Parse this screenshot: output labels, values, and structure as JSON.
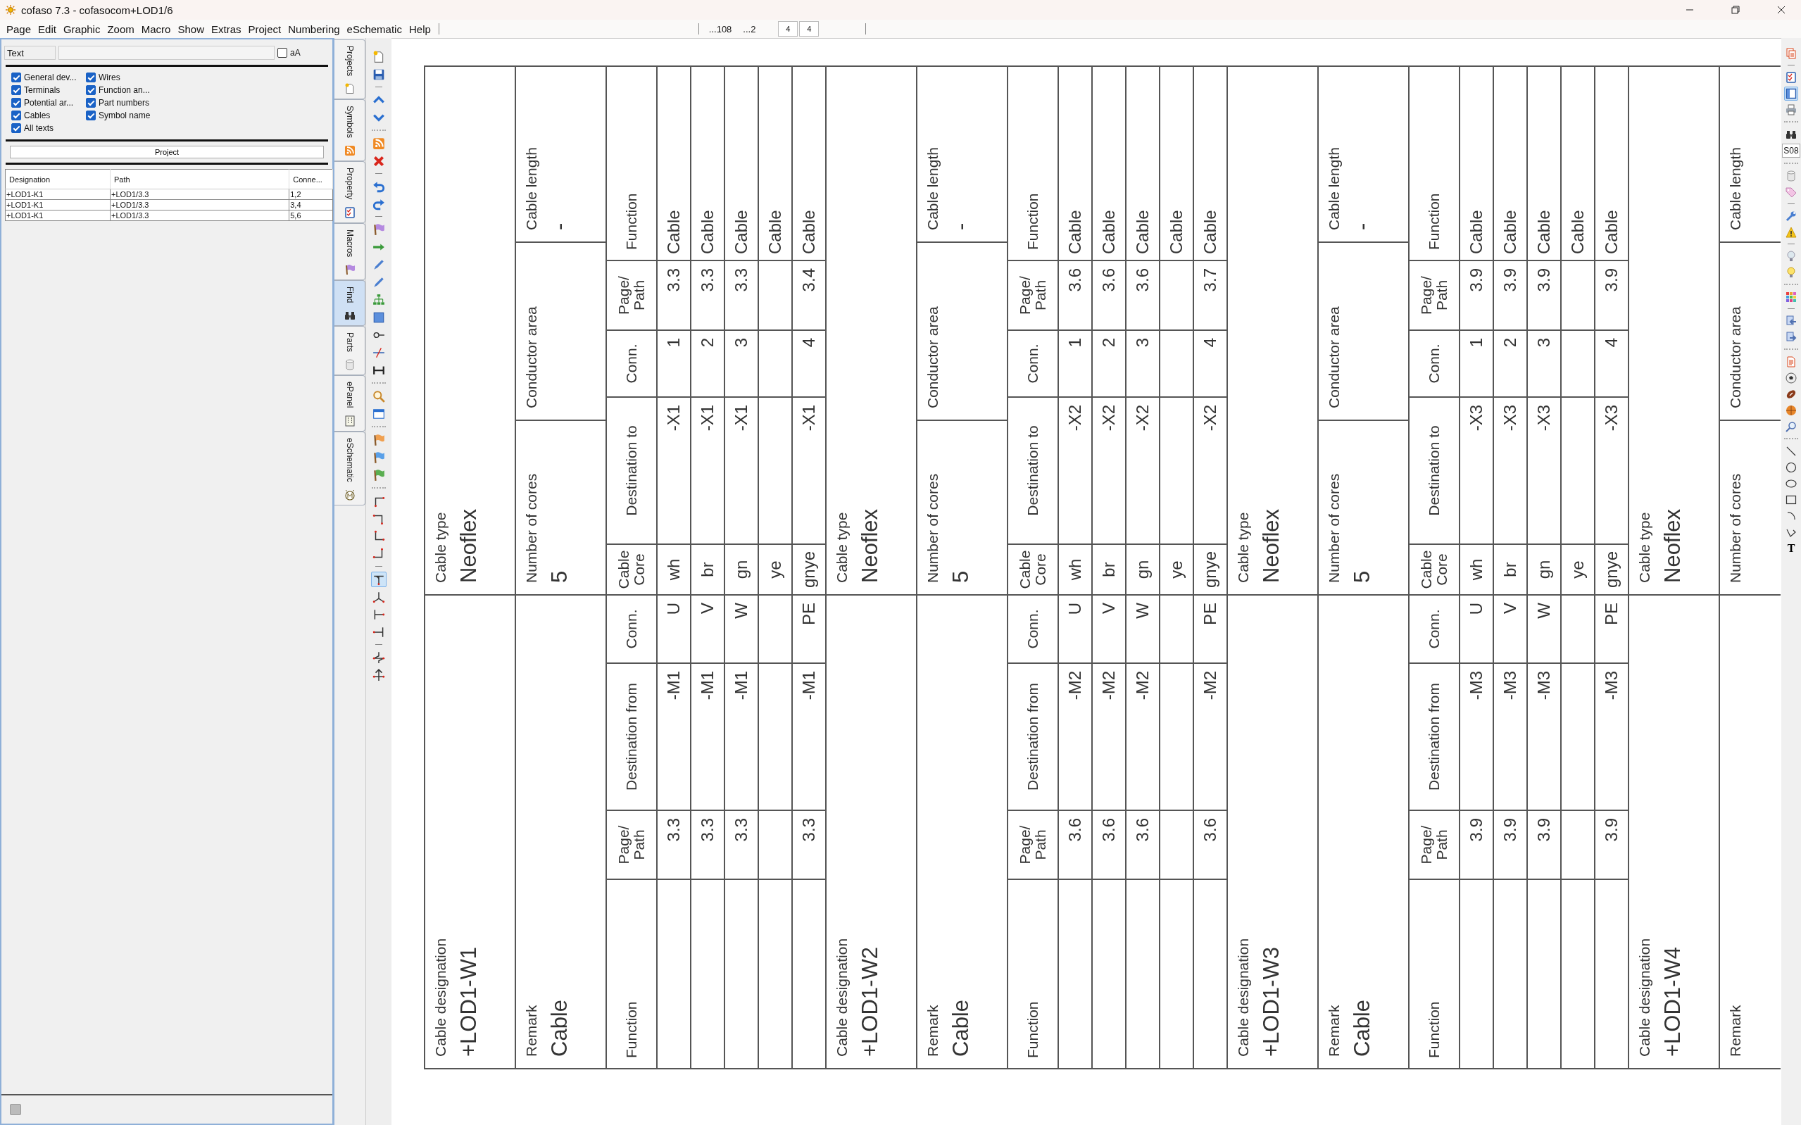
{
  "window": {
    "title": "cofaso 7.3 - cofasocom+LOD1/6"
  },
  "menu": [
    "Page",
    "Edit",
    "Graphic",
    "Zoom",
    "Macro",
    "Show",
    "Extras",
    "Project",
    "Numbering",
    "eSchematic",
    "Help"
  ],
  "menu_status": {
    "fields": [
      "...108",
      "...2"
    ],
    "boxes": [
      "4",
      "4"
    ]
  },
  "find_panel": {
    "search_label": "Text",
    "case_option": {
      "label": "aA",
      "checked": false
    },
    "filters": [
      {
        "label": "General dev...",
        "checked": true
      },
      {
        "label": "Wires",
        "checked": true
      },
      {
        "label": "Terminals",
        "checked": true
      },
      {
        "label": "Function an...",
        "checked": true
      },
      {
        "label": "Potential ar...",
        "checked": true
      },
      {
        "label": "Part numbers",
        "checked": true
      },
      {
        "label": "Cables",
        "checked": true
      },
      {
        "label": "Symbol name",
        "checked": true
      },
      {
        "label": "All texts",
        "checked": true
      }
    ],
    "scope_button": "Project",
    "columns": [
      "Designation",
      "Path",
      "Conne..."
    ],
    "rows": [
      [
        "+LOD1-K1",
        "+LOD1/3.3",
        "1,2"
      ],
      [
        "+LOD1-K1",
        "+LOD1/3.3",
        "3,4"
      ],
      [
        "+LOD1-K1",
        "+LOD1/3.3",
        "5,6"
      ]
    ]
  },
  "side_tabs": [
    {
      "label": "Projects",
      "selected": false
    },
    {
      "label": "Symbols",
      "selected": false
    },
    {
      "label": "Property",
      "selected": false
    },
    {
      "label": "Macros",
      "selected": false
    },
    {
      "label": "Find",
      "selected": true
    },
    {
      "label": "Parts",
      "selected": false
    },
    {
      "label": "ePanel",
      "selected": false
    },
    {
      "label": "eSchematic",
      "selected": false
    }
  ],
  "left_toolbar": [
    {
      "selected": false
    },
    {
      "selected": false
    },
    {
      "selected": false
    },
    {
      "selected": false
    },
    {
      "selected": false
    },
    {
      "selected": false
    },
    {
      "selected": false
    },
    {
      "selected": false
    },
    {
      "selected": false
    },
    {
      "selected": false
    },
    {
      "selected": false
    },
    {
      "selected": false
    },
    {
      "selected": false
    },
    {
      "selected": false
    },
    {
      "selected": false
    },
    {
      "selected": false
    },
    {
      "selected": false
    },
    {
      "selected": false
    },
    {
      "selected": false
    },
    {
      "selected": false
    },
    {
      "selected": false
    },
    {
      "selected": false
    },
    {
      "selected": false
    },
    {
      "selected": false
    },
    {
      "selected": false
    },
    {
      "selected": false
    },
    {
      "selected": true
    },
    {
      "selected": false
    },
    {
      "selected": false
    },
    {
      "selected": false
    },
    {
      "selected": false
    },
    {
      "selected": false
    }
  ],
  "right_toolbar": {
    "items": [
      {
        "selected": false
      },
      {
        "selected": false
      },
      {
        "selected": true
      },
      {
        "selected": false
      },
      {
        "selected": false
      },
      {
        "selected": false
      },
      {
        "selected": false
      },
      {
        "selected": false
      },
      {
        "selected": false
      },
      {
        "selected": false
      },
      {
        "selected": false
      },
      {
        "selected": false
      },
      {
        "selected": false
      },
      {
        "selected": false
      },
      {
        "selected": false
      },
      {
        "selected": false
      },
      {
        "selected": false
      },
      {
        "selected": false
      },
      {
        "selected": false
      },
      {
        "selected": false
      },
      {
        "selected": false
      },
      {
        "selected": false
      },
      {
        "selected": false
      },
      {
        "selected": false
      },
      {
        "selected": false
      }
    ],
    "page_field": "S08",
    "text_button": "T"
  },
  "cables": [
    {
      "designation": {
        "label": "Cable designation",
        "value": "+LOD1-W1"
      },
      "type": {
        "label": "Cable type",
        "value": "Neoflex"
      },
      "remark": {
        "label": "Remark",
        "value": "Cable"
      },
      "cores_count": {
        "label": "Number of cores",
        "value": "5"
      },
      "conductor_area": {
        "label": "Conductor area"
      },
      "length": {
        "label": "Cable length",
        "value": "-"
      },
      "header": [
        "Function",
        "Page/\nPath",
        "Destination from",
        "Conn.",
        "Cable\nCore",
        "Destination to",
        "Conn.",
        "Page/\nPath",
        "Function"
      ],
      "cores": [
        {
          "page_from": "3.3",
          "from": "-M1",
          "from_conn": "U",
          "core": "wh",
          "to": "-X1",
          "to_conn": "1",
          "page_to": "3.3",
          "function": "Cable"
        },
        {
          "page_from": "3.3",
          "from": "-M1",
          "from_conn": "V",
          "core": "br",
          "to": "-X1",
          "to_conn": "2",
          "page_to": "3.3",
          "function": "Cable"
        },
        {
          "page_from": "3.3",
          "from": "-M1",
          "from_conn": "W",
          "core": "gn",
          "to": "-X1",
          "to_conn": "3",
          "page_to": "3.3",
          "function": "Cable"
        },
        {
          "core": "ye",
          "function": "Cable"
        },
        {
          "page_from": "3.3",
          "from": "-M1",
          "from_conn": "PE",
          "core": "gnye",
          "to": "-X1",
          "to_conn": "4",
          "page_to": "3.4",
          "function": "Cable"
        }
      ]
    },
    {
      "designation": {
        "label": "Cable designation",
        "value": "+LOD1-W2"
      },
      "type": {
        "label": "Cable type",
        "value": "Neoflex"
      },
      "remark": {
        "label": "Remark",
        "value": "Cable"
      },
      "cores_count": {
        "label": "Number of cores",
        "value": "5"
      },
      "conductor_area": {
        "label": "Conductor area"
      },
      "length": {
        "label": "Cable length",
        "value": "-"
      },
      "header": [
        "Function",
        "Page/\nPath",
        "Destination from",
        "Conn.",
        "Cable\nCore",
        "Destination to",
        "Conn.",
        "Page/\nPath",
        "Function"
      ],
      "cores": [
        {
          "page_from": "3.6",
          "from": "-M2",
          "from_conn": "U",
          "core": "wh",
          "to": "-X2",
          "to_conn": "1",
          "page_to": "3.6",
          "function": "Cable"
        },
        {
          "page_from": "3.6",
          "from": "-M2",
          "from_conn": "V",
          "core": "br",
          "to": "-X2",
          "to_conn": "2",
          "page_to": "3.6",
          "function": "Cable"
        },
        {
          "page_from": "3.6",
          "from": "-M2",
          "from_conn": "W",
          "core": "gn",
          "to": "-X2",
          "to_conn": "3",
          "page_to": "3.6",
          "function": "Cable"
        },
        {
          "core": "ye",
          "function": "Cable"
        },
        {
          "page_from": "3.6",
          "from": "-M2",
          "from_conn": "PE",
          "core": "gnye",
          "to": "-X2",
          "to_conn": "4",
          "page_to": "3.7",
          "function": "Cable"
        }
      ]
    },
    {
      "designation": {
        "label": "Cable designation",
        "value": "+LOD1-W3"
      },
      "type": {
        "label": "Cable type",
        "value": "Neoflex"
      },
      "remark": {
        "label": "Remark",
        "value": "Cable"
      },
      "cores_count": {
        "label": "Number of cores",
        "value": "5"
      },
      "conductor_area": {
        "label": "Conductor area"
      },
      "length": {
        "label": "Cable length",
        "value": "-"
      },
      "header": [
        "Function",
        "Page/\nPath",
        "Destination from",
        "Conn.",
        "Cable\nCore",
        "Destination to",
        "Conn.",
        "Page/\nPath",
        "Function"
      ],
      "cores": [
        {
          "page_from": "3.9",
          "from": "-M3",
          "from_conn": "U",
          "core": "wh",
          "to": "-X3",
          "to_conn": "1",
          "page_to": "3.9",
          "function": "Cable"
        },
        {
          "page_from": "3.9",
          "from": "-M3",
          "from_conn": "V",
          "core": "br",
          "to": "-X3",
          "to_conn": "2",
          "page_to": "3.9",
          "function": "Cable"
        },
        {
          "page_from": "3.9",
          "from": "-M3",
          "from_conn": "W",
          "core": "gn",
          "to": "-X3",
          "to_conn": "3",
          "page_to": "3.9",
          "function": "Cable"
        },
        {
          "core": "ye",
          "function": "Cable"
        },
        {
          "page_from": "3.9",
          "from": "-M3",
          "from_conn": "PE",
          "core": "gnye",
          "to": "-X3",
          "to_conn": "4",
          "page_to": "3.9",
          "function": "Cable"
        }
      ]
    },
    {
      "designation": {
        "label": "Cable designation",
        "value": "+LOD1-W4"
      },
      "type": {
        "label": "Cable type",
        "value": "Neoflex"
      },
      "remark": {
        "label": "Remark"
      },
      "cores_count": {
        "label": "Number of cores"
      },
      "conductor_area": {
        "label": "Conductor area"
      },
      "length": {
        "label": "Cable length"
      }
    }
  ]
}
